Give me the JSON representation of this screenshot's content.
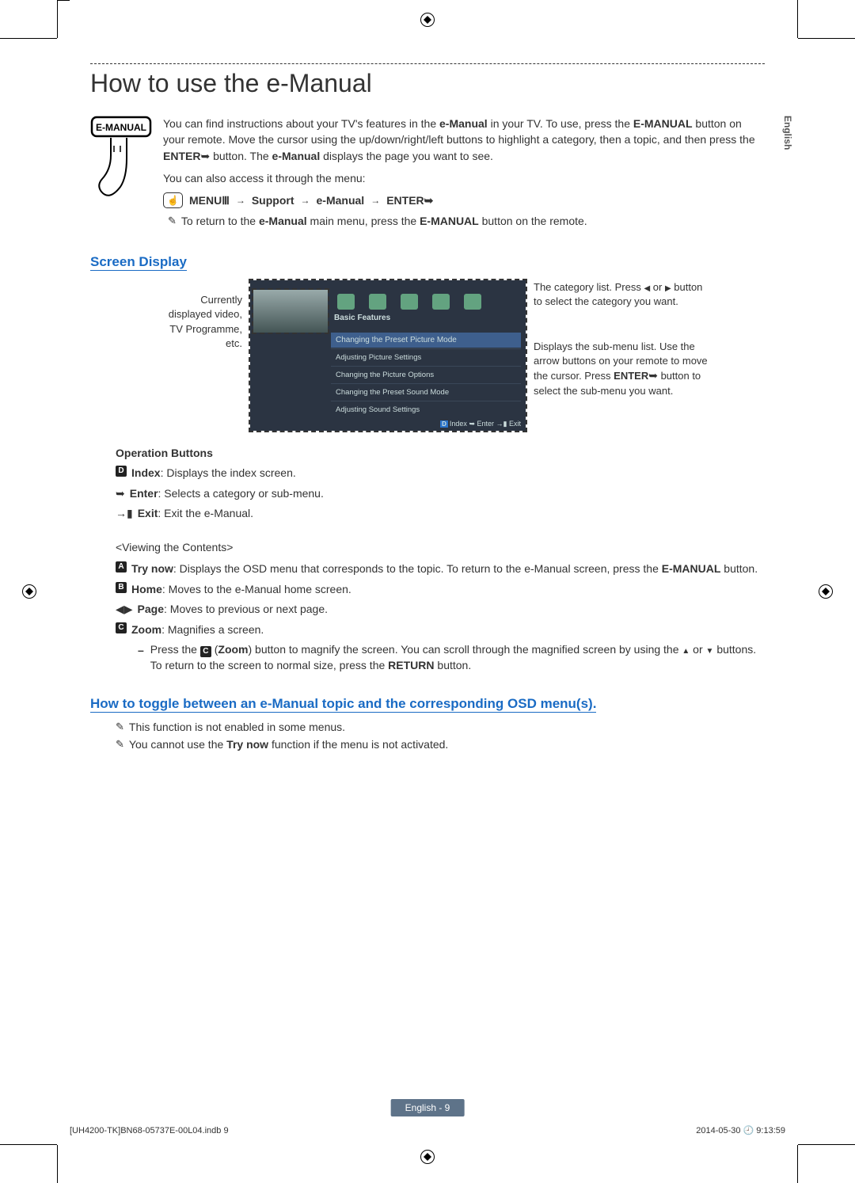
{
  "side_tab": "English",
  "title": "How to use the e-Manual",
  "intro": {
    "remote_button_label": "E-MANUAL",
    "p1a": "You can find instructions about your TV's features in the ",
    "p1b": "e-Manual",
    "p1c": " in your TV. To use, press the ",
    "p1d": "E-MANUAL",
    "p1e": " button on your remote. Move the cursor using the up/down/right/left buttons to highlight a category, then a topic, and then press the ",
    "p1f": "ENTER",
    "p1g": " button. The ",
    "p1h": "e-Manual",
    "p1i": " displays the page you want to see.",
    "p2": "You can also access it through the menu:",
    "path_menu": "MENU",
    "path_support": "Support",
    "path_emanual": "e-Manual",
    "path_enter": "ENTER",
    "note1a": "To return to the ",
    "note1b": "e-Manual",
    "note1c": " main menu, press the ",
    "note1d": "E-MANUAL",
    "note1e": " button on the remote."
  },
  "screen_display": {
    "heading": "Screen Display",
    "left_callout_l1": "Currently",
    "left_callout_l2": "displayed video,",
    "left_callout_l3": "TV Programme,",
    "left_callout_l4": "etc.",
    "right_callout_1a": "The category list. Press ",
    "right_callout_1b": " or ",
    "right_callout_1c": " button to select the category you want.",
    "right_callout_2a": "Displays the sub-menu list. Use the arrow buttons on your remote to move the cursor. Press ",
    "right_callout_2b": "ENTER",
    "right_callout_2c": " button to select the sub-menu you want.",
    "screenshot": {
      "header": "Basic Features",
      "title_item": "Changing the Preset Picture Mode",
      "items": [
        "Adjusting Picture Settings",
        "Changing the Picture Options",
        "Changing the Preset Sound Mode",
        "Adjusting Sound Settings"
      ],
      "footer_index": "Index",
      "footer_enter": "Enter",
      "footer_exit": "Exit"
    }
  },
  "operation_buttons": {
    "heading": "Operation Buttons",
    "index_label": "Index",
    "index_desc": ": Displays the index screen.",
    "enter_label": "Enter",
    "enter_desc": ": Selects a category or sub-menu.",
    "exit_label": "Exit",
    "exit_desc": ": Exit the e-Manual."
  },
  "viewing_contents": {
    "heading": "<Viewing the Contents>",
    "trynow_label": "Try now",
    "trynow_desc": ": Displays the OSD menu that corresponds to the topic. To return to the e-Manual screen, press the ",
    "trynow_btn": "E-MANUAL",
    "trynow_tail": " button.",
    "home_label": "Home",
    "home_desc": ": Moves to the e-Manual home screen.",
    "page_label": "Page",
    "page_desc": ": Moves to previous or next page.",
    "zoom_label": "Zoom",
    "zoom_desc": ": Magnifies a screen.",
    "zoom_sub_a": "Press the ",
    "zoom_sub_b": "Zoom",
    "zoom_sub_c": ") button to magnify the screen. You can scroll through the magnified screen by using the ",
    "zoom_sub_d": " or ",
    "zoom_sub_e": " buttons. To return to the screen to normal size, press the ",
    "zoom_sub_f": "RETURN",
    "zoom_sub_g": " button."
  },
  "toggle_section": {
    "heading": "How to toggle between an e-Manual topic and the corresponding OSD menu(s).",
    "note1": "This function is not enabled in some menus.",
    "note2a": "You cannot use the ",
    "note2b": "Try now",
    "note2c": " function if the menu is not activated."
  },
  "footer": {
    "page_label": "English - 9",
    "print_file": "[UH4200-TK]BN68-05737E-00L04.indb   9",
    "print_date": "2014-05-30   🕘 9:13:59"
  },
  "badges": {
    "D": "D",
    "A": "A",
    "B": "B",
    "C": "C"
  }
}
